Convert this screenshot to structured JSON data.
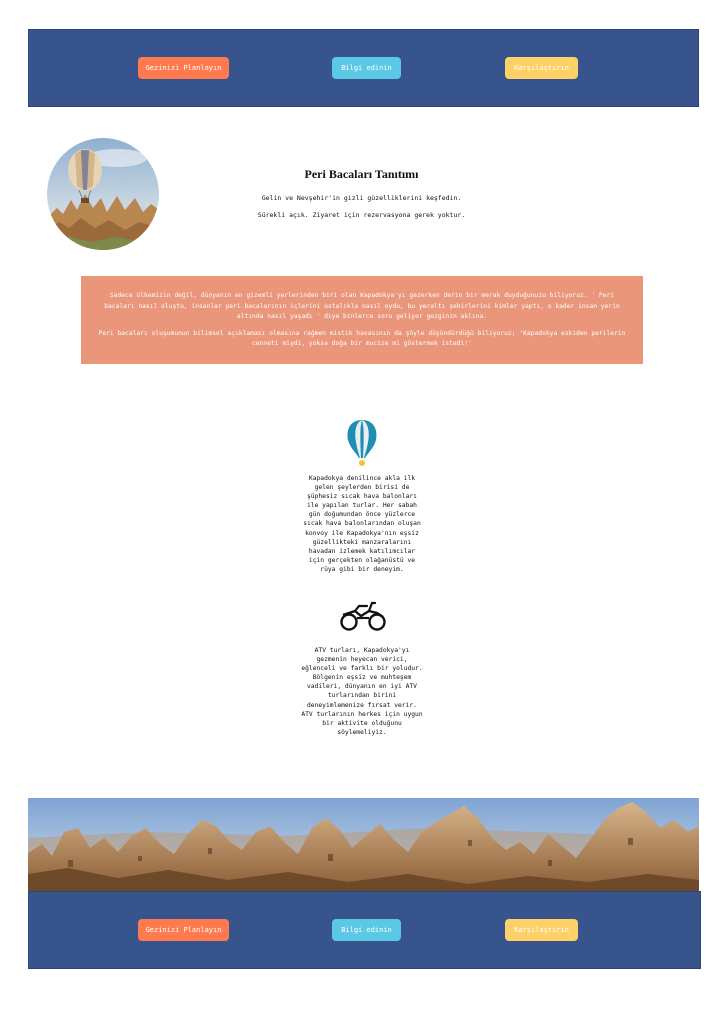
{
  "nav_top": {
    "plan": "Gezinizi Planlayın",
    "info": "Bilgi edinin",
    "compare": "Karşılaştırın"
  },
  "hero": {
    "title": "Peri Bacaları Tanıtımı",
    "line1": "Gelin ve Nevşehir'in gizli güzelliklerini keşfedin.",
    "line2": "Sürekli açık. Ziyaret için rezervasyona gerek yoktur."
  },
  "intro": {
    "p1": "Sadece ülkemizin değil, dünyanın en gizemli yerlerinden biri olan Kapadokya'yı gezerken derin bir merak duyduğunuzu biliyoruz. ' Peri bacaları nasıl oluştu, insanlar peri bacalarının içlerini ustalıkla nasıl oydu, bu yeraltı şehirlerini kimler yaptı, o kader insan yerin altında nasıl yaşadı ' diye binlerce soru geliyor gezginin aklına.",
    "p2": "Peri bacaları oluşumunun bilimsel açıklaması olmasına rağmen mistik havasının da şöyle düşündürdüğü biliyoruz; 'Kapadokya eskiden perilerin cenneti miydi, yoksa doğa bir mucize mi göstermek istedi!'"
  },
  "features": {
    "balloon_text": "Kapadokya denilince akla ilk gelen şeylerden birisi de şüphesiz sıcak hava balonları ile yapılan turlar. Her sabah gün doğumundan önce yüzlerce sıcak hava balonlarından oluşan konvoy ile Kapadokya'nın eşsiz güzellikteki manzaralarını havadan izlemek katılımcılar için gerçekten olağanüstü ve rüya gibi bir deneyim.",
    "atv_text": "ATV turları, Kapadokya'yı gezmenin heyecan verici, eğlenceli ve farklı bir yoludur. Bölgenin eşsiz ve muhteşem vadileri, dünyanın en iyi ATV turlarından birini deneyimlemenize fırsat verir. ATV turlarının herkes için uygun bir aktivite olduğunu söylemeliyiz."
  },
  "nav_bottom": {
    "plan": "Gezinizi Planlayın",
    "info": "Bilgi edinin",
    "compare": "Karşılaştırın"
  },
  "colors": {
    "nav": "#37558c",
    "plan": "#ff7a4f",
    "info": "#5bc8e6",
    "compare": "#fdd167",
    "intro_bg": "#e9967b",
    "balloon_blue": "#1e8fb3"
  },
  "icons": {
    "balloon": "hot-air-balloon-icon",
    "atv": "atv-quad-icon"
  }
}
